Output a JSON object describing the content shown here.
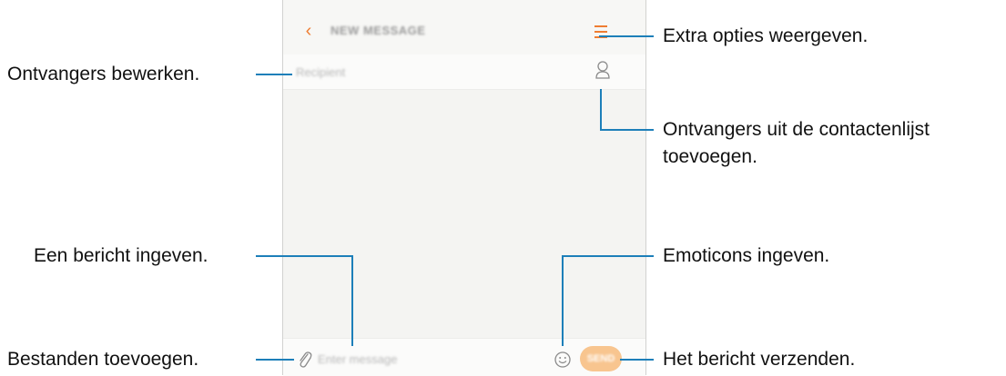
{
  "screen": {
    "app_title": "NEW MESSAGE",
    "recipient_placeholder": "Recipient",
    "message_placeholder": "Enter message",
    "send_label": "SEND"
  },
  "icons": {
    "back": "chevron-left-icon",
    "menu": "menu-lines-icon",
    "contacts": "person-icon",
    "attach": "paperclip-icon",
    "emoji": "smiley-icon"
  },
  "colors": {
    "accent": "#ef7d32",
    "send_button": "#f8c58f",
    "callout_line": "#1d7fb9"
  },
  "callouts": {
    "more_options": "Extra opties weergeven.",
    "edit_recipients": "Ontvangers bewerken.",
    "contacts_line1": "Ontvangers uit de contactenlijst",
    "contacts_line2": "toevoegen.",
    "enter_message": "Een bericht ingeven.",
    "enter_emoticons": "Emoticons ingeven.",
    "attach_files": "Bestanden toevoegen.",
    "send_message": "Het bericht verzenden."
  }
}
